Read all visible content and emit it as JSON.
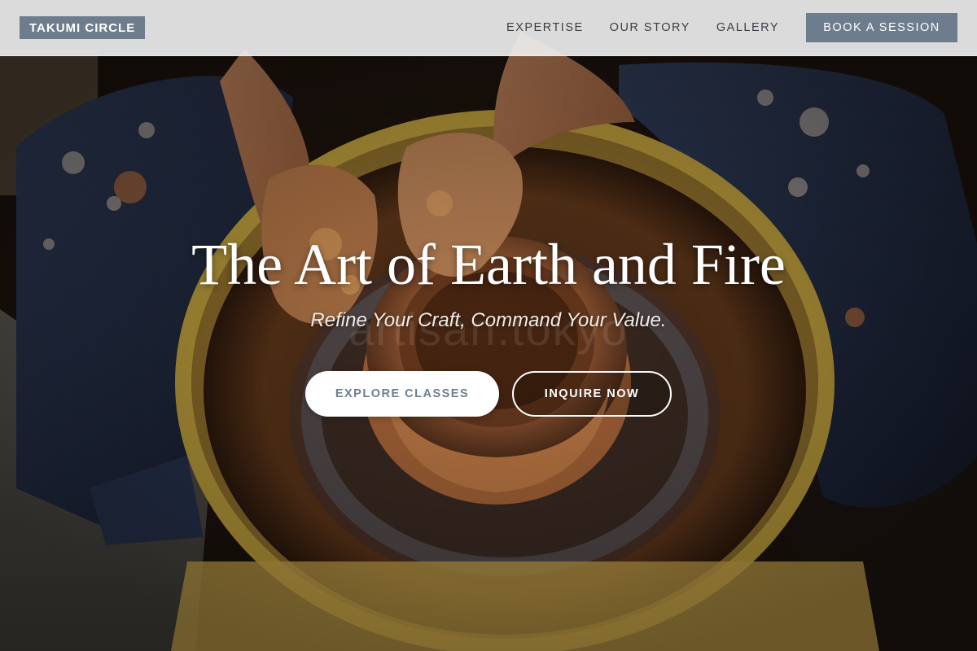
{
  "brand": {
    "name": "TAKUMI CIRCLE"
  },
  "nav": {
    "links": [
      "EXPERTISE",
      "OUR STORY",
      "GALLERY"
    ],
    "cta_label": "BOOK A SESSION"
  },
  "hero": {
    "title": "The Art of Earth and Fire",
    "subtitle": "Refine Your Craft, Command Your Value.",
    "watermark": "artisan.tokyo",
    "primary_button": "EXPLORE CLASSES",
    "secondary_button": "INQUIRE NOW",
    "background_description_icon": "pottery-wheel-photo"
  },
  "colors": {
    "accent": "#6e7d8e",
    "nav_bg": "#ececec",
    "text_light": "#ffffff"
  }
}
